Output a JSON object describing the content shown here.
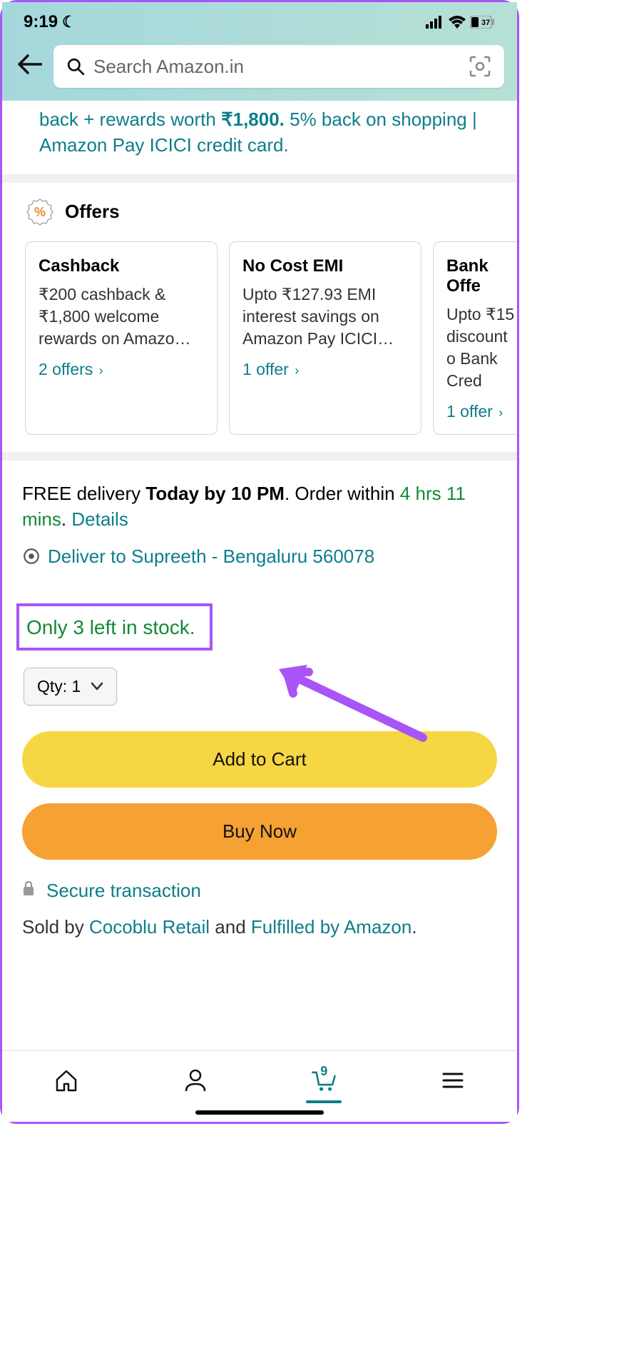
{
  "statusBar": {
    "time": "9:19",
    "battery": "37"
  },
  "search": {
    "placeholder": "Search Amazon.in"
  },
  "promo": {
    "prefix": "back + rewards worth ",
    "amount": "₹1,800.",
    "suffix": " 5% back on shopping | Amazon Pay ICICI credit card."
  },
  "offers": {
    "title": "Offers",
    "cards": [
      {
        "title": "Cashback",
        "desc": "₹200 cashback & ₹1,800 welcome rewards on Amazo…",
        "link": "2 offers"
      },
      {
        "title": "No Cost EMI",
        "desc": "Upto ₹127.93 EMI interest savings on Amazon Pay ICICI…",
        "link": "1 offer"
      },
      {
        "title": "Bank Offe",
        "desc": "Upto ₹15 discount o Bank Cred",
        "link": "1 offer"
      }
    ]
  },
  "delivery": {
    "free": "FREE delivery ",
    "by": "Today by 10 PM",
    "orderWithin": ". Order within ",
    "time": "4 hrs 11 mins",
    "period": ". ",
    "details": "Details",
    "location": "Deliver to Supreeth - Bengaluru 560078"
  },
  "stock": "Only 3 left in stock.",
  "qty": {
    "label": "Qty: 1"
  },
  "buttons": {
    "addToCart": "Add to Cart",
    "buyNow": "Buy Now"
  },
  "secure": "Secure transaction",
  "soldBy": {
    "prefix": "Sold by ",
    "seller": "Cocoblu Retail",
    "and": " and ",
    "fulfilled": "Fulfilled by Amazon",
    "suffix": "."
  },
  "nav": {
    "cartCount": "9"
  }
}
